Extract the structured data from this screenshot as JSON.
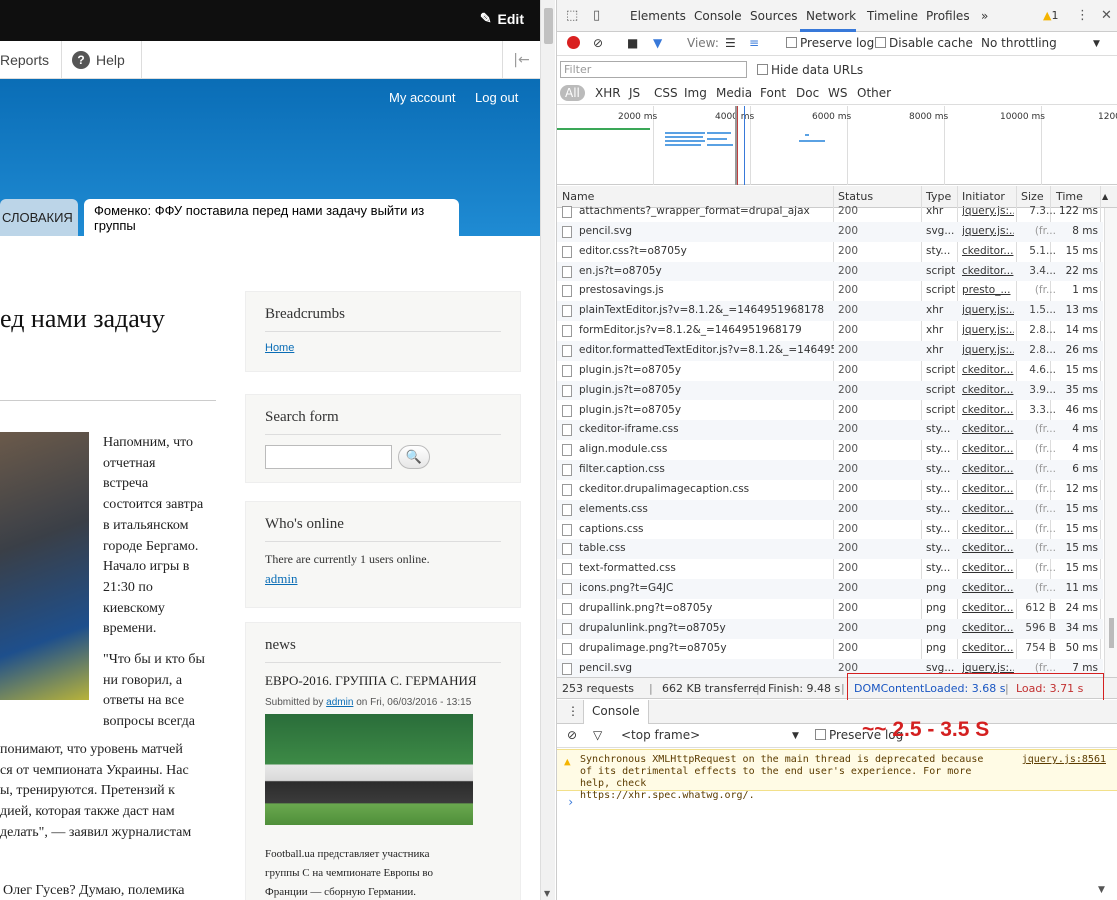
{
  "site": {
    "edit_label": "Edit",
    "tray": {
      "reports": "Reports",
      "help": "Help"
    },
    "header": {
      "my_account": "My account",
      "logout": "Log out",
      "tab1": "СЛОВАКИЯ",
      "tab2": "Фоменко: ФФУ поставила перед нами задачу выйти из группы"
    },
    "article": {
      "title_fragment": "ед нами задачу",
      "text_col": [
        "Напомним, что",
        "отчетная",
        "встреча",
        "состоится завтра",
        "в итальянском",
        "городе Бергамо.",
        "Начало игры в",
        "21:30 по",
        "киевскому",
        "времени."
      ],
      "text_col2": [
        "\"Что бы и кто бы",
        "ни говорил, а",
        "ответы на все",
        "вопросы всегда"
      ],
      "text_full": [
        "понимают, что уровень матчей",
        "ся от чемпионата Украины. Нас",
        "ы, тренируются. Претензий к",
        "дией, которая также даст нам",
        "делать\", — заявил журналистам"
      ],
      "last_line": "Олег Гусев? Думаю, полемика"
    },
    "blocks": {
      "breadcrumbs_title": "Breadcrumbs",
      "breadcrumbs_home": "Home",
      "search_title": "Search form",
      "online_title": "Who's online",
      "online_text": "There are currently 1 users online.",
      "online_user": "admin",
      "news_title": "news",
      "news_item_title": "ЕВРО-2016. ГРУППА С. ГЕРМАНИЯ",
      "news_submitted": "Submitted by",
      "news_author": "admin",
      "news_date": "on Fri, 06/03/2016 - 13:15",
      "news_desc": [
        "Football.ua представляет участника",
        "группы С на чемпионате Европы во",
        "Франции — сборную Германии."
      ]
    }
  },
  "devtools": {
    "tabs": [
      "Elements",
      "Console",
      "Sources",
      "Network",
      "Timeline",
      "Profiles"
    ],
    "more": "»",
    "warning_count": "1",
    "toolbar": {
      "view": "View:",
      "preserve_log": "Preserve log",
      "disable_cache": "Disable cache",
      "throttling": "No throttling"
    },
    "filter_placeholder": "Filter",
    "hide_data_urls": "Hide data URLs",
    "types": [
      "All",
      "XHR",
      "JS",
      "CSS",
      "Img",
      "Media",
      "Font",
      "Doc",
      "WS",
      "Other"
    ],
    "timeline_ticks": [
      "2000 ms",
      "4000 ms",
      "6000 ms",
      "8000 ms",
      "10000 ms",
      "1200"
    ],
    "columns": [
      "Name",
      "Status",
      "Type",
      "Initiator",
      "Size",
      "Time"
    ],
    "rows": [
      {
        "name": "attachments?_wrapper_format=drupal_ajax",
        "status": "200",
        "type": "xhr",
        "initiator": "jquery.js:...",
        "size": "7.3...",
        "time": "122 ms"
      },
      {
        "name": "pencil.svg",
        "status": "200",
        "type": "svg...",
        "initiator": "jquery.js:...",
        "size": "(fr...",
        "time": "8 ms"
      },
      {
        "name": "editor.css?t=o8705y",
        "status": "200",
        "type": "sty...",
        "initiator": "ckeditor...",
        "size": "5.1...",
        "time": "15 ms"
      },
      {
        "name": "en.js?t=o8705y",
        "status": "200",
        "type": "script",
        "initiator": "ckeditor...",
        "size": "3.4...",
        "time": "22 ms"
      },
      {
        "name": "prestosavings.js",
        "status": "200",
        "type": "script",
        "initiator": "presto_...",
        "size": "(fr...",
        "time": "1 ms"
      },
      {
        "name": "plainTextEditor.js?v=8.1.2&_=1464951968178",
        "status": "200",
        "type": "xhr",
        "initiator": "jquery.js:...",
        "size": "1.5...",
        "time": "13 ms"
      },
      {
        "name": "formEditor.js?v=8.1.2&_=1464951968179",
        "status": "200",
        "type": "xhr",
        "initiator": "jquery.js:...",
        "size": "2.8...",
        "time": "14 ms"
      },
      {
        "name": "editor.formattedTextEditor.js?v=8.1.2&_=1464951...",
        "status": "200",
        "type": "xhr",
        "initiator": "jquery.js:...",
        "size": "2.8...",
        "time": "26 ms"
      },
      {
        "name": "plugin.js?t=o8705y",
        "status": "200",
        "type": "script",
        "initiator": "ckeditor...",
        "size": "4.6...",
        "time": "15 ms"
      },
      {
        "name": "plugin.js?t=o8705y",
        "status": "200",
        "type": "script",
        "initiator": "ckeditor...",
        "size": "3.9...",
        "time": "35 ms"
      },
      {
        "name": "plugin.js?t=o8705y",
        "status": "200",
        "type": "script",
        "initiator": "ckeditor...",
        "size": "3.3...",
        "time": "46 ms"
      },
      {
        "name": "ckeditor-iframe.css",
        "status": "200",
        "type": "sty...",
        "initiator": "ckeditor...",
        "size": "(fr...",
        "time": "4 ms"
      },
      {
        "name": "align.module.css",
        "status": "200",
        "type": "sty...",
        "initiator": "ckeditor...",
        "size": "(fr...",
        "time": "4 ms"
      },
      {
        "name": "filter.caption.css",
        "status": "200",
        "type": "sty...",
        "initiator": "ckeditor...",
        "size": "(fr...",
        "time": "6 ms"
      },
      {
        "name": "ckeditor.drupalimagecaption.css",
        "status": "200",
        "type": "sty...",
        "initiator": "ckeditor...",
        "size": "(fr...",
        "time": "12 ms"
      },
      {
        "name": "elements.css",
        "status": "200",
        "type": "sty...",
        "initiator": "ckeditor...",
        "size": "(fr...",
        "time": "15 ms"
      },
      {
        "name": "captions.css",
        "status": "200",
        "type": "sty...",
        "initiator": "ckeditor...",
        "size": "(fr...",
        "time": "15 ms"
      },
      {
        "name": "table.css",
        "status": "200",
        "type": "sty...",
        "initiator": "ckeditor...",
        "size": "(fr...",
        "time": "15 ms"
      },
      {
        "name": "text-formatted.css",
        "status": "200",
        "type": "sty...",
        "initiator": "ckeditor...",
        "size": "(fr...",
        "time": "15 ms"
      },
      {
        "name": "icons.png?t=G4JC",
        "status": "200",
        "type": "png",
        "initiator": "ckeditor...",
        "size": "(fr...",
        "time": "11 ms"
      },
      {
        "name": "drupallink.png?t=o8705y",
        "status": "200",
        "type": "png",
        "initiator": "ckeditor...",
        "size": "612 B",
        "time": "24 ms"
      },
      {
        "name": "drupalunlink.png?t=o8705y",
        "status": "200",
        "type": "png",
        "initiator": "ckeditor...",
        "size": "596 B",
        "time": "34 ms"
      },
      {
        "name": "drupalimage.png?t=o8705y",
        "status": "200",
        "type": "png",
        "initiator": "ckeditor...",
        "size": "754 B",
        "time": "50 ms"
      },
      {
        "name": "pencil.svg",
        "status": "200",
        "type": "svg...",
        "initiator": "jquery.js:...",
        "size": "(fr...",
        "time": "7 ms"
      }
    ],
    "summary": {
      "requests": "253 requests",
      "transferred": "662 KB transferred",
      "finish": "Finish: 9.48 s",
      "dom_content_loaded": "DOMContentLoaded: 3.68 s",
      "load": "Load: 3.71 s"
    },
    "console": {
      "tab": "Console",
      "context": "<top frame>",
      "preserve_log": "Preserve log",
      "warning": "Synchronous XMLHttpRequest on the main thread is deprecated because\nof its detrimental effects to the end user's experience. For more help, check\nhttps://xhr.spec.whatwg.org/.",
      "warning_source": "jquery.js:8561",
      "prompt": "›"
    },
    "annotation": "~~ 2.5 - 3.5 S",
    "colors": {
      "accent": "#3879d9",
      "record": "#d92020",
      "annotation": "#d42020"
    }
  }
}
